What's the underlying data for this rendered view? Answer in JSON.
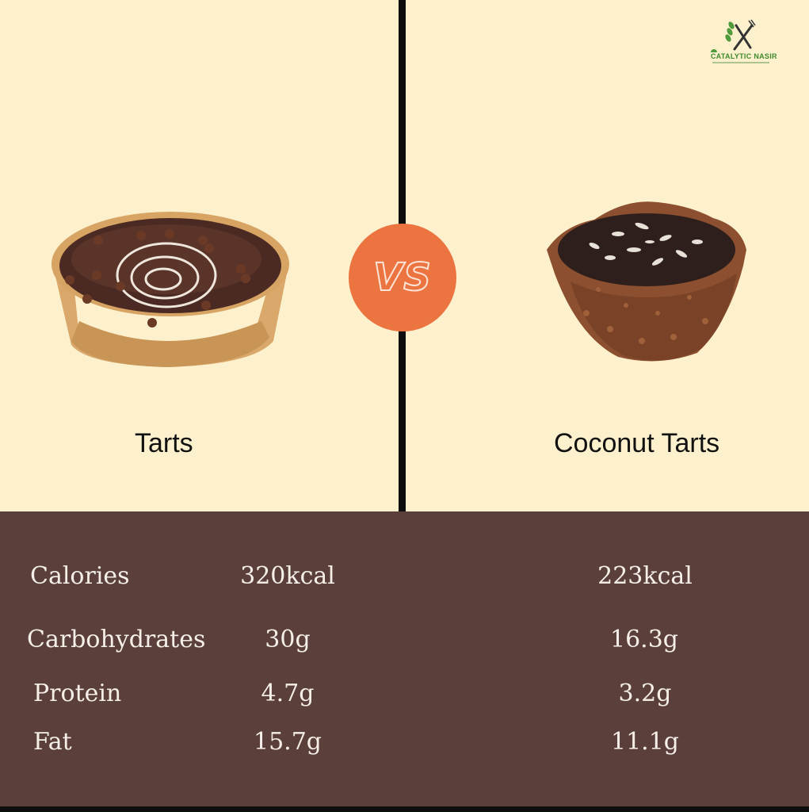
{
  "vs_label": "VS",
  "logo": {
    "text": "CATALYTIC NASIR",
    "icon": "fork-knife-icon"
  },
  "left": {
    "name": "Tarts",
    "image": "chocolate-tart-image"
  },
  "right": {
    "name": "Coconut Tarts",
    "image": "coconut-tart-image"
  },
  "nutrition": {
    "rows": [
      {
        "label": "Calories",
        "left": "320kcal",
        "right": "223kcal"
      },
      {
        "label": "Carbohydrates",
        "left": "30g",
        "right": "16.3g"
      },
      {
        "label": "Protein",
        "left": "4.7g",
        "right": "3.2g"
      },
      {
        "label": "Fat",
        "left": "15.7g",
        "right": "11.1g"
      }
    ]
  },
  "colors": {
    "top_background": "#fdf1cd",
    "bottom_background": "#5a3f3b",
    "vs_circle": "#ec7440",
    "divider": "#0d0d0d",
    "text_light": "#f6efe8"
  }
}
